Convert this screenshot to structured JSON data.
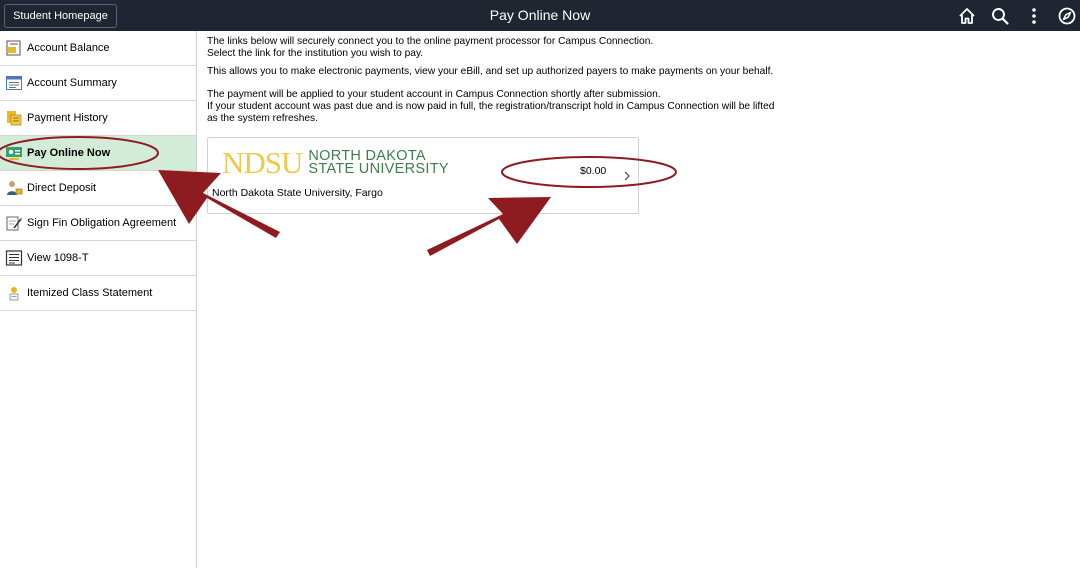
{
  "header": {
    "home_button_label": "Student Homepage",
    "title": "Pay Online Now",
    "icons": [
      "home-icon",
      "search-icon",
      "more-options-icon",
      "nav-bar-icon"
    ]
  },
  "sidebar": {
    "items": [
      {
        "label": "Account Balance",
        "icon": "account-balance-icon",
        "active": false
      },
      {
        "label": "Account Summary",
        "icon": "account-summary-icon",
        "active": false
      },
      {
        "label": "Payment History",
        "icon": "payment-history-icon",
        "active": false
      },
      {
        "label": "Pay Online Now",
        "icon": "pay-online-icon",
        "active": true
      },
      {
        "label": "Direct Deposit",
        "icon": "direct-deposit-icon",
        "active": false
      },
      {
        "label": "Sign Fin Obligation Agreement",
        "icon": "sign-agreement-icon",
        "active": false
      },
      {
        "label": "View 1098-T",
        "icon": "form-1098t-icon",
        "active": false
      },
      {
        "label": "Itemized Class Statement",
        "icon": "itemized-statement-icon",
        "active": false
      }
    ]
  },
  "main": {
    "intro_line1": "The links below will securely connect you to the online payment processor for Campus Connection.",
    "intro_line2": "Select the link for the institution you wish to pay.",
    "allows_text": "This allows you to make electronic payments, view your eBill, and set up authorized payers to make payments on your behalf.",
    "applied_line1": "The payment will be applied to your student account in Campus Connection shortly after submission.",
    "applied_line2": "If your student account was past due and is now paid in full, the registration/transcript hold in Campus Connection will be lifted",
    "applied_line3": "as the system refreshes.",
    "institution": {
      "logo_abbrev": "NDSU",
      "logo_line1": "NORTH DAKOTA",
      "logo_line2": "STATE UNIVERSITY",
      "name": "North Dakota State University, Fargo",
      "amount": "$0.00"
    }
  },
  "colors": {
    "header_bg": "#1f2631",
    "active_item_bg": "#d2ecd8",
    "annotation_red": "#8e1b1f",
    "ndsu_gold": "#f0c84a",
    "ndsu_green": "#3d7e4e"
  }
}
